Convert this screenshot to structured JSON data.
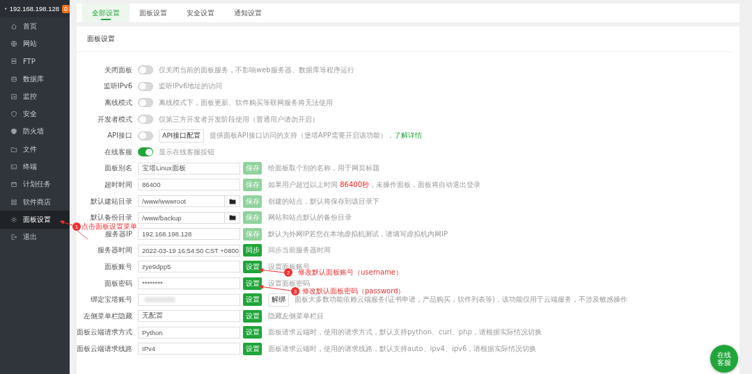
{
  "sidebar": {
    "host": "192.168.198.128",
    "badge": "0",
    "items": [
      {
        "label": "首页",
        "selected": false
      },
      {
        "label": "网站",
        "selected": false
      },
      {
        "label": "FTP",
        "selected": false
      },
      {
        "label": "数据库",
        "selected": false
      },
      {
        "label": "监控",
        "selected": false
      },
      {
        "label": "安全",
        "selected": false
      },
      {
        "label": "防火墙",
        "selected": false
      },
      {
        "label": "文件",
        "selected": false
      },
      {
        "label": "终端",
        "selected": false
      },
      {
        "label": "计划任务",
        "selected": false
      },
      {
        "label": "软件商店",
        "selected": false
      },
      {
        "label": "面板设置",
        "selected": true
      },
      {
        "label": "退出",
        "selected": false
      }
    ]
  },
  "tabs": [
    {
      "label": "全部设置",
      "selected": true
    },
    {
      "label": "面板设置",
      "selected": false
    },
    {
      "label": "安全设置",
      "selected": false
    },
    {
      "label": "通知设置",
      "selected": false
    }
  ],
  "section_title": "面板设置",
  "rows": [
    {
      "kind": "toggle",
      "label": "关闭面板",
      "on": false,
      "description": [
        {
          "kind": "plain",
          "text": "仅关闭当前的面板服务，不影响web服务器、数据库等程序运行"
        }
      ]
    },
    {
      "kind": "toggle",
      "label": "监听IPv6",
      "on": false,
      "description": [
        {
          "kind": "plain",
          "text": "监听IPv6地址的访问"
        }
      ]
    },
    {
      "kind": "toggle",
      "label": "离线模式",
      "on": false,
      "description": [
        {
          "kind": "plain",
          "text": "离线模式下，面板更新、软件购买等联网服务将无法使用"
        }
      ]
    },
    {
      "kind": "toggle",
      "label": "开发者模式",
      "on": false,
      "description": [
        {
          "kind": "plain",
          "text": "仅第三方开发者开发阶段使用（普通用户请勿开启）"
        }
      ]
    },
    {
      "kind": "toggle",
      "label": "API接口",
      "on": false,
      "button": "API接口配置",
      "description": [
        {
          "kind": "plain",
          "text": "提供面板API接口访问的支持（堡塔APP需要开启该功能），"
        },
        {
          "kind": "link",
          "text": "了解详情"
        }
      ]
    },
    {
      "kind": "toggle",
      "label": "在线客服",
      "on": true,
      "description": [
        {
          "kind": "plain",
          "text": "显示在线客服按钮"
        }
      ]
    },
    {
      "kind": "input",
      "label": "面板别名",
      "value": "宝塔Linux面板",
      "button": {
        "label": "保存",
        "disabled": true
      },
      "description": [
        {
          "kind": "plain",
          "text": "给面板取个别的名称，用于网页标题"
        }
      ]
    },
    {
      "kind": "input",
      "label": "超时时间",
      "value": "86400",
      "button": {
        "label": "保存",
        "disabled": true
      },
      "description": [
        {
          "kind": "plain",
          "text": "如果用户超过以上时间 "
        },
        {
          "kind": "warning",
          "text": "86400秒"
        },
        {
          "kind": "plain",
          "text": "，未操作面板，面板将自动退出登录"
        }
      ]
    },
    {
      "kind": "path",
      "label": "默认建站目录",
      "value": "/www/wwwroot",
      "button": {
        "label": "保存",
        "disabled": true
      },
      "description": [
        {
          "kind": "plain",
          "text": "创建的站点，默认将保存到该目录下"
        }
      ]
    },
    {
      "kind": "path",
      "label": "默认备份目录",
      "value": "/www/backup",
      "button": {
        "label": "保存",
        "disabled": true
      },
      "description": [
        {
          "kind": "plain",
          "text": "网站和站点默认的备份目录"
        }
      ]
    },
    {
      "kind": "input",
      "label": "服务器IP",
      "value": "192.168.198.128",
      "button": {
        "label": "保存",
        "disabled": true
      },
      "description": [
        {
          "kind": "plain",
          "text": "默认为外网IP若您在本地虚拟机测试，请填写虚拟机内网IP"
        }
      ]
    },
    {
      "kind": "input",
      "label": "服务器时间",
      "value": "2022-03-19 16:54:50 CST +0800",
      "button": {
        "label": "同步",
        "disabled": false
      },
      "description": [
        {
          "kind": "plain",
          "text": "同步当前服务器时间"
        }
      ]
    },
    {
      "kind": "input",
      "label": "面板账号",
      "value": "zye9dpp5",
      "button": {
        "label": "设置",
        "disabled": false
      },
      "description": [
        {
          "kind": "plain",
          "text": "设置面板账号"
        }
      ]
    },
    {
      "kind": "input",
      "label": "面板密码",
      "value": "********",
      "button": {
        "label": "设置",
        "disabled": false
      },
      "description": [
        {
          "kind": "plain",
          "text": "设置面板密码"
        }
      ]
    },
    {
      "kind": "bind",
      "label": "绑定宝塔账号",
      "button": {
        "label": "设置",
        "disabled": false
      },
      "unbind": "解绑",
      "description": [
        {
          "kind": "plain",
          "text": "面板大多数功能依赖云端服务(证书申请，产品购买，软件列表等)，该功能仅用于云端服务，不涉及敏感操作"
        }
      ]
    },
    {
      "kind": "input",
      "label": "左侧菜单栏隐藏",
      "value": "无配置",
      "button": {
        "label": "设置",
        "disabled": false
      },
      "description": [
        {
          "kind": "plain",
          "text": "隐藏左侧菜单栏目"
        }
      ]
    },
    {
      "kind": "input",
      "label": "面板云端请求方式",
      "value": "Python",
      "button": {
        "label": "设置",
        "disabled": false
      },
      "description": [
        {
          "kind": "plain",
          "text": "面板请求云端时，使用的请求方式，默认支持python、curl、php，请根据实际情况切换"
        }
      ]
    },
    {
      "kind": "input",
      "label": "面板云端请求线路",
      "value": "IPv4",
      "button": {
        "label": "设置",
        "disabled": false
      },
      "description": [
        {
          "kind": "plain",
          "text": "面板请求云端时，使用的请求线路，默认支持auto、ipv4、ipv6，请根据实际情况切换"
        }
      ]
    }
  ],
  "annotations": [
    {
      "number": "1",
      "text": "点击面板设置菜单"
    },
    {
      "number": "2",
      "text": "修改默认面板账号（username）"
    },
    {
      "number": "3",
      "text": "修改默认面板密码（password）"
    }
  ],
  "chat_button": "在线客服"
}
